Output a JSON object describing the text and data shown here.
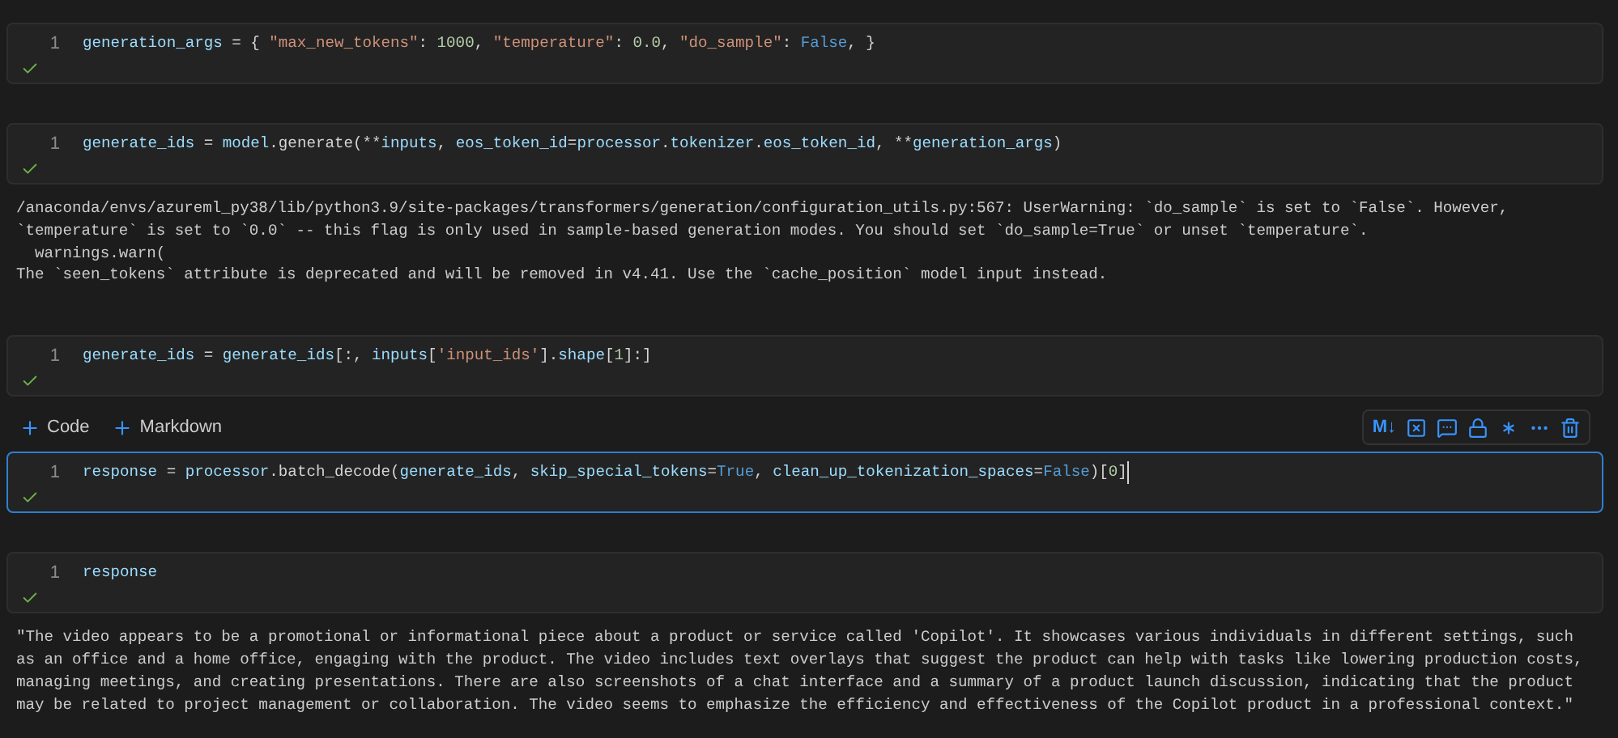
{
  "cells": [
    {
      "kind": "code",
      "line_number": "1",
      "succeeded": true,
      "selected": false,
      "cursor": false,
      "tokens": [
        {
          "text": "generation_args",
          "kind": "var"
        },
        {
          "text": " = { ",
          "kind": "plain"
        },
        {
          "text": "\"max_new_tokens\"",
          "kind": "str"
        },
        {
          "text": ": ",
          "kind": "plain"
        },
        {
          "text": "1000",
          "kind": "num"
        },
        {
          "text": ", ",
          "kind": "plain"
        },
        {
          "text": "\"temperature\"",
          "kind": "str"
        },
        {
          "text": ": ",
          "kind": "plain"
        },
        {
          "text": "0.0",
          "kind": "num"
        },
        {
          "text": ", ",
          "kind": "plain"
        },
        {
          "text": "\"do_sample\"",
          "kind": "str"
        },
        {
          "text": ": ",
          "kind": "plain"
        },
        {
          "text": "False",
          "kind": "kw"
        },
        {
          "text": ", }",
          "kind": "plain"
        }
      ]
    },
    {
      "kind": "code",
      "line_number": "1",
      "succeeded": true,
      "selected": false,
      "cursor": false,
      "tokens": [
        {
          "text": "generate_ids",
          "kind": "var"
        },
        {
          "text": " = ",
          "kind": "plain"
        },
        {
          "text": "model",
          "kind": "var"
        },
        {
          "text": ".generate(**",
          "kind": "plain"
        },
        {
          "text": "inputs",
          "kind": "var"
        },
        {
          "text": ", ",
          "kind": "plain"
        },
        {
          "text": "eos_token_id",
          "kind": "var"
        },
        {
          "text": "=",
          "kind": "plain"
        },
        {
          "text": "processor",
          "kind": "var"
        },
        {
          "text": ".",
          "kind": "plain"
        },
        {
          "text": "tokenizer",
          "kind": "var"
        },
        {
          "text": ".",
          "kind": "plain"
        },
        {
          "text": "eos_token_id",
          "kind": "var"
        },
        {
          "text": ", **",
          "kind": "plain"
        },
        {
          "text": "generation_args",
          "kind": "var"
        },
        {
          "text": ")",
          "kind": "plain"
        }
      ],
      "outputs": [
        "/anaconda/envs/azureml_py38/lib/python3.9/site-packages/transformers/generation/configuration_utils.py:567: UserWarning: `do_sample` is set to `False`. However,",
        "`temperature` is set to `0.0` -- this flag is only used in sample-based generation modes. You should set `do_sample=True` or unset `temperature`.",
        "  warnings.warn(",
        "The `seen_tokens` attribute is deprecated and will be removed in v4.41. Use the `cache_position` model input instead."
      ]
    },
    {
      "kind": "code",
      "line_number": "1",
      "succeeded": true,
      "selected": false,
      "cursor": false,
      "tokens": [
        {
          "text": "generate_ids",
          "kind": "var"
        },
        {
          "text": " = ",
          "kind": "plain"
        },
        {
          "text": "generate_ids",
          "kind": "var"
        },
        {
          "text": "[:, ",
          "kind": "plain"
        },
        {
          "text": "inputs",
          "kind": "var"
        },
        {
          "text": "[",
          "kind": "plain"
        },
        {
          "text": "'input_ids'",
          "kind": "str"
        },
        {
          "text": "].",
          "kind": "plain"
        },
        {
          "text": "shape",
          "kind": "var"
        },
        {
          "text": "[",
          "kind": "plain"
        },
        {
          "text": "1",
          "kind": "num"
        },
        {
          "text": "]:]",
          "kind": "plain"
        }
      ]
    },
    {
      "kind": "insert_bar",
      "buttons": [
        "Code",
        "Markdown"
      ],
      "markdown_label": "M↓"
    },
    {
      "kind": "code",
      "line_number": "1",
      "succeeded": true,
      "selected": true,
      "cursor": true,
      "tokens": [
        {
          "text": "response",
          "kind": "var"
        },
        {
          "text": " = ",
          "kind": "plain"
        },
        {
          "text": "processor",
          "kind": "var"
        },
        {
          "text": ".batch_decode(",
          "kind": "plain"
        },
        {
          "text": "generate_ids",
          "kind": "var"
        },
        {
          "text": ", ",
          "kind": "plain"
        },
        {
          "text": "skip_special_tokens",
          "kind": "var"
        },
        {
          "text": "=",
          "kind": "plain"
        },
        {
          "text": "True",
          "kind": "kw"
        },
        {
          "text": ", ",
          "kind": "plain"
        },
        {
          "text": "clean_up_tokenization_spaces",
          "kind": "var"
        },
        {
          "text": "=",
          "kind": "plain"
        },
        {
          "text": "False",
          "kind": "kw"
        },
        {
          "text": ")[",
          "kind": "plain"
        },
        {
          "text": "0",
          "kind": "num"
        },
        {
          "text": "]",
          "kind": "plain"
        }
      ]
    },
    {
      "kind": "code",
      "line_number": "1",
      "succeeded": true,
      "selected": false,
      "cursor": false,
      "tokens": [
        {
          "text": "response",
          "kind": "var"
        }
      ],
      "outputs": [
        "\"The video appears to be a promotional or informational piece about a product or service called 'Copilot'. It showcases various individuals in different settings, such",
        "as an office and a home office, engaging with the product. The video includes text overlays that suggest the product can help with tasks like lowering production costs,",
        "managing meetings, and creating presentations. There are also screenshots of a chat interface and a summary of a product launch discussion, indicating that the product",
        "may be related to project management or collaboration. The video seems to emphasize the efficiency and effectiveness of the Copilot product in a professional context.\""
      ]
    }
  ]
}
